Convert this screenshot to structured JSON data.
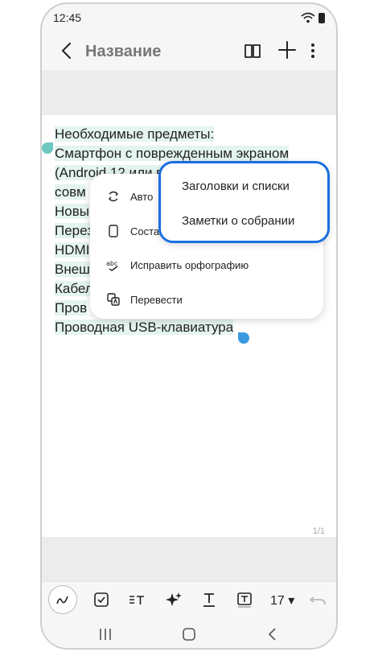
{
  "status_bar": {
    "time": "12:45",
    "wifi_icon": "wifi-icon",
    "battery_icon": "battery-icon"
  },
  "app_bar": {
    "title": "Название",
    "back_icon": "back-arrow-icon",
    "book_icon": "book-icon",
    "add_icon": "plus-icon",
    "more_icon": "more-vertical-icon"
  },
  "note": {
    "lines": [
      "Необходимые предметы:",
      "Смартфон с поврежденным экраном",
      "(Android 12 или в",
      "совм",
      "Новы",
      "Перез",
      "HDMI",
      "Внеш",
      "Кабел",
      "Пров",
      "Проводная USB-клавиатура"
    ],
    "selection_color": "#e4f4ef",
    "page_counter": "1/1"
  },
  "context_menu": {
    "items": [
      {
        "label": "Авто",
        "icon": "auto-format-icon"
      },
      {
        "label": "Соста",
        "icon": "compose-icon"
      },
      {
        "label": "Исправить орфографию",
        "icon": "spellcheck-icon"
      },
      {
        "label": "Перевести",
        "icon": "translate-icon"
      }
    ]
  },
  "submenu": {
    "items": [
      {
        "label": "Заголовки и списки"
      },
      {
        "label": "Заметки о собрании"
      }
    ],
    "highlight_color": "#1a6fe0"
  },
  "toolbar": {
    "tools": [
      "pen-icon",
      "checkbox-icon",
      "text-format-icon",
      "sparkle-icon",
      "underline-text-icon",
      "text-box-icon"
    ],
    "font_size": "17",
    "undo_icon": "undo-icon"
  },
  "nav_bar": {
    "recents_icon": "recents-icon",
    "home_icon": "home-icon",
    "back_icon": "nav-back-icon"
  }
}
